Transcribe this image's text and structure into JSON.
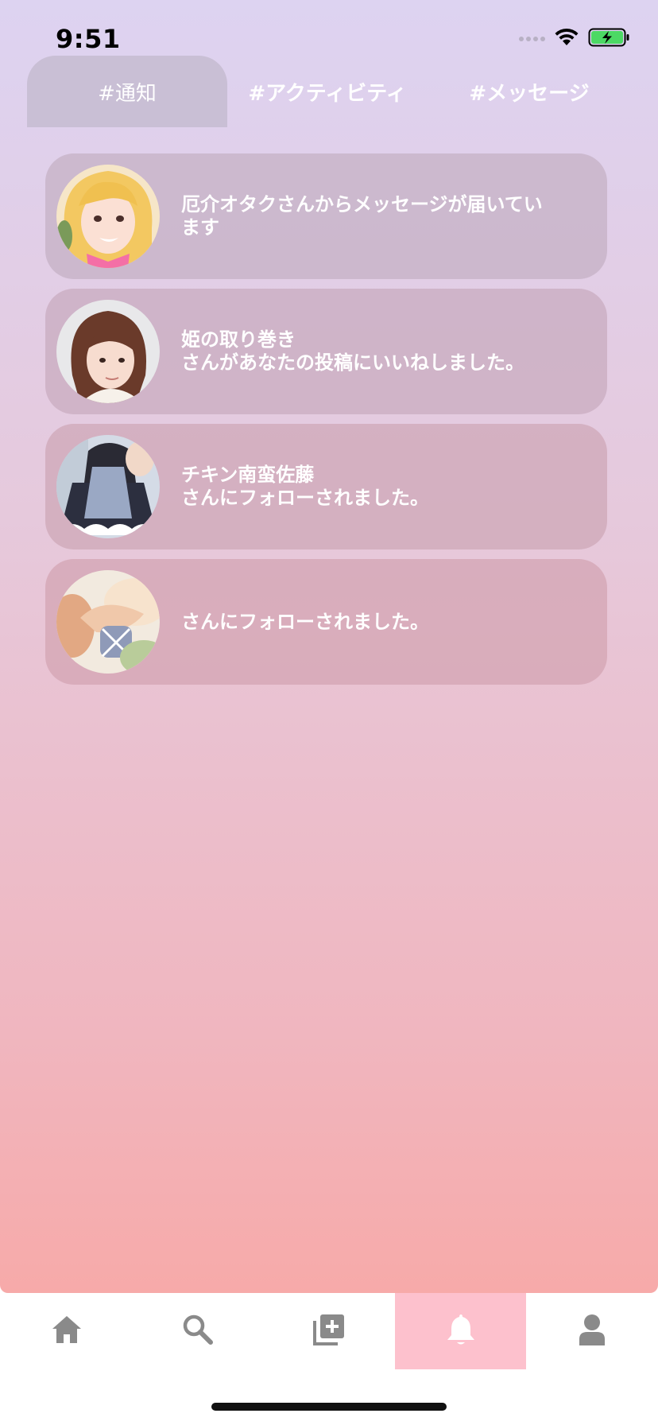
{
  "status_bar": {
    "time": "9:51"
  },
  "tabs": [
    {
      "label": "#通知",
      "active": true
    },
    {
      "label": "#アクティビティ",
      "active": false
    },
    {
      "label": "#メッセージ",
      "active": false
    }
  ],
  "notifications": [
    {
      "name": "",
      "message": "厄介オタクさんからメッセージが届いています"
    },
    {
      "name": "姫の取り巻き",
      "message": "さんがあなたの投稿にいいねしました。"
    },
    {
      "name": "チキン南蛮佐藤",
      "message": "さんにフォローされました。"
    },
    {
      "name": "",
      "message": "さんにフォローされました。"
    }
  ],
  "tab_bar": {
    "items": [
      {
        "icon": "home-icon",
        "active": false
      },
      {
        "icon": "search-icon",
        "active": false
      },
      {
        "icon": "add-post-icon",
        "active": false
      },
      {
        "icon": "bell-icon",
        "active": true
      },
      {
        "icon": "user-icon",
        "active": false
      }
    ]
  },
  "colors": {
    "gradient_top": "#ddd3f1",
    "gradient_bottom": "#f7aaa9",
    "active_tab_bg": "#c9bfd5",
    "tabbar_active_bg": "#fdc1cd",
    "tabbar_icon": "#8a8a8a",
    "battery_green": "#4cd964"
  }
}
